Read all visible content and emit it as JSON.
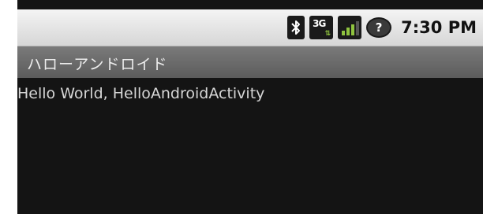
{
  "status_bar": {
    "icons": [
      "bluetooth-icon",
      "3g-data-icon",
      "signal-strength-icon",
      "unknown-notification-icon"
    ],
    "network_label": "3G",
    "help_glyph": "?",
    "time": "7:30 PM",
    "signal_level": 0.75,
    "accent_color": "#8fc33f"
  },
  "app_bar": {
    "title": "ハローアンドロイド"
  },
  "main": {
    "text": "Hello World, HelloAndroidActivity"
  }
}
